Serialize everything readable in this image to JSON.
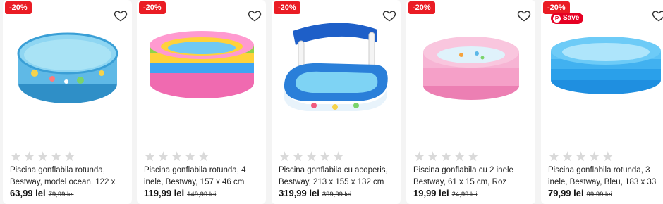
{
  "products": [
    {
      "discount": "-20%",
      "title": "Piscina gonflabila rotunda, Bestway, model ocean, 122 x",
      "price": "63,99 lei",
      "old_price": "79,99 lei",
      "image_icon": "ocean-pool-image"
    },
    {
      "discount": "-20%",
      "title": "Piscina gonflabila rotunda, 4 inele, Bestway, 157 x 46 cm",
      "price": "119,99 lei",
      "old_price": "149,99 lei",
      "image_icon": "rainbow-pool-image"
    },
    {
      "discount": "-20%",
      "title": "Piscina gonflabila cu acoperis, Bestway, 213 x 155 x 132 cm",
      "price": "319,99 lei",
      "old_price": "399,99 lei",
      "image_icon": "boat-pool-with-canopy-image"
    },
    {
      "discount": "-20%",
      "title": "Piscina gonflabila cu 2 inele Bestway, 61 x 15 cm, Roz",
      "price": "19,99 lei",
      "old_price": "24,99 lei",
      "image_icon": "pink-pool-image"
    },
    {
      "discount": "-20%",
      "title": "Piscina gonflabila rotunda, 3 inele, Bestway, Bleu, 183 x 33",
      "price": "79,99 lei",
      "old_price": "99,99 lei",
      "image_icon": "blue-pool-image",
      "pin_label": "Save"
    }
  ],
  "rating_stars": 0,
  "colors": {
    "badge": "#ea1c24",
    "pinterest": "#e60023",
    "star_empty": "#d9d9d9"
  }
}
